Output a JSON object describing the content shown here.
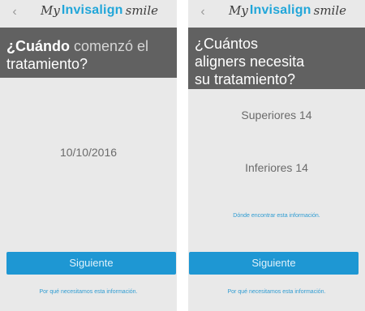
{
  "logo": {
    "my": "My",
    "brand": "Invisalign",
    "smile": "smile"
  },
  "left": {
    "question": {
      "bold": "¿Cuándo",
      "light": " comenzó el",
      "line2": "tratamiento?"
    },
    "date_value": "10/10/2016",
    "next_button": "Siguiente",
    "why_link": "Por qué necesitamos esta información."
  },
  "right": {
    "question": {
      "line1": "¿Cuántos",
      "line2": "aligners necesita",
      "line3": "su tratamiento?"
    },
    "upper": "Superiores 14",
    "lower": "Inferiores 14",
    "where_link": "Dónde encontrar esta información.",
    "next_button": "Siguiente",
    "why_link": "Por qué necesitamos esta información."
  },
  "icons": {
    "back": "back-chevron-icon"
  }
}
